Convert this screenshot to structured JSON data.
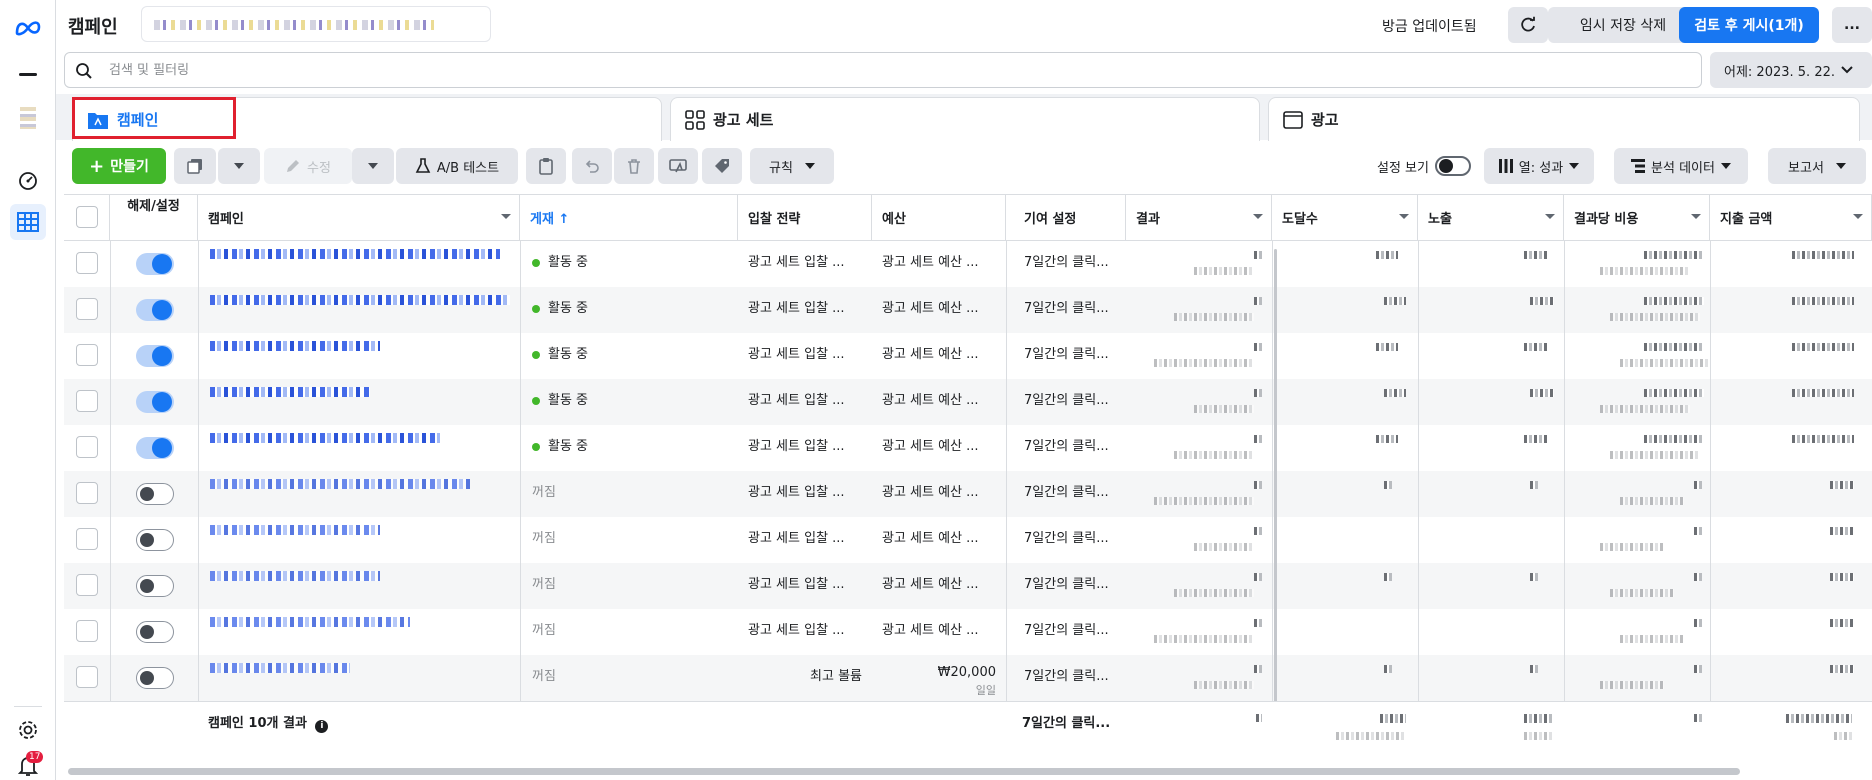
{
  "header": {
    "title": "캠페인",
    "updated_text": "방금 업데이트됨",
    "discard_draft": "임시 저장 삭제",
    "review_publish": "검토 후 게시(1개)",
    "more": "..."
  },
  "search": {
    "placeholder": "검색 및 필터링"
  },
  "date_range": {
    "label": "어제: 2023. 5. 22."
  },
  "tabs": [
    {
      "label": "캠페인"
    },
    {
      "label": "광고 세트"
    },
    {
      "label": "광고"
    }
  ],
  "toolbar": {
    "create": "만들기",
    "edit": "수정",
    "ab_test": "A/B 테스트",
    "rules": "규칙",
    "view_setup": "설정 보기",
    "columns": "열: 성과",
    "breakdown": "분석 데이터",
    "reports": "보고서"
  },
  "table": {
    "columns": {
      "onoff": "해제/설정",
      "campaign": "캠페인",
      "delivery": "게재",
      "bid_strategy": "입찰 전략",
      "budget": "예산",
      "attribution": "기여 설정",
      "results": "결과",
      "reach": "도달수",
      "impressions": "노출",
      "cost_per_result": "결과당 비용",
      "amount_spent": "지출 금액"
    },
    "rows": [
      {
        "on": true,
        "delivery": "활동 중",
        "bid": "광고 세트 입찰 ...",
        "budget": "광고 세트 예산 ...",
        "budget_sub": "",
        "attribution": "7일간의 클릭..."
      },
      {
        "on": true,
        "delivery": "활동 중",
        "bid": "광고 세트 입찰 ...",
        "budget": "광고 세트 예산 ...",
        "budget_sub": "",
        "attribution": "7일간의 클릭..."
      },
      {
        "on": true,
        "delivery": "활동 중",
        "bid": "광고 세트 입찰 ...",
        "budget": "광고 세트 예산 ...",
        "budget_sub": "",
        "attribution": "7일간의 클릭..."
      },
      {
        "on": true,
        "delivery": "활동 중",
        "bid": "광고 세트 입찰 ...",
        "budget": "광고 세트 예산 ...",
        "budget_sub": "",
        "attribution": "7일간의 클릭..."
      },
      {
        "on": true,
        "delivery": "활동 중",
        "bid": "광고 세트 입찰 ...",
        "budget": "광고 세트 예산 ...",
        "budget_sub": "",
        "attribution": "7일간의 클릭..."
      },
      {
        "on": false,
        "delivery": "꺼짐",
        "bid": "광고 세트 입찰 ...",
        "budget": "광고 세트 예산 ...",
        "budget_sub": "",
        "attribution": "7일간의 클릭..."
      },
      {
        "on": false,
        "delivery": "꺼짐",
        "bid": "광고 세트 입찰 ...",
        "budget": "광고 세트 예산 ...",
        "budget_sub": "",
        "attribution": "7일간의 클릭..."
      },
      {
        "on": false,
        "delivery": "꺼짐",
        "bid": "광고 세트 입찰 ...",
        "budget": "광고 세트 예산 ...",
        "budget_sub": "",
        "attribution": "7일간의 클릭..."
      },
      {
        "on": false,
        "delivery": "꺼짐",
        "bid": "광고 세트 입찰 ...",
        "budget": "광고 세트 예산 ...",
        "budget_sub": "",
        "attribution": "7일간의 클릭..."
      },
      {
        "on": false,
        "delivery": "꺼짐",
        "bid": "최고 볼륨",
        "budget": "₩20,000",
        "budget_sub": "일일",
        "attribution": "7일간의 클릭..."
      }
    ],
    "summary": {
      "label": "캠페인 10개 결과",
      "attribution": "7일간의 클릭..."
    }
  },
  "notifications": {
    "count": "17"
  },
  "colors": {
    "accent": "#1877f2",
    "create_green": "#42b72a",
    "active_dot": "#42b72a",
    "highlight_border": "#e0202f"
  }
}
